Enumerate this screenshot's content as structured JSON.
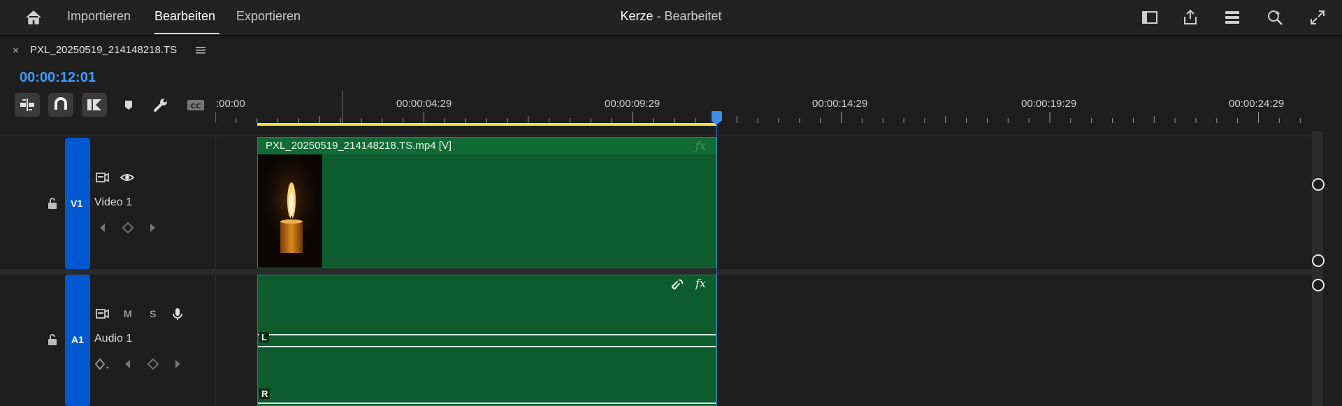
{
  "topbar": {
    "nav": [
      "Importieren",
      "Bearbeiten",
      "Exportieren"
    ],
    "active_nav": "Bearbeiten",
    "project_name": "Kerze",
    "project_status": " - Bearbeitet",
    "icons": [
      "home-icon",
      "panel-layout-icon",
      "share-icon",
      "settings-sliders-icon",
      "zoom-search-icon",
      "fullscreen-icon"
    ]
  },
  "sequence": {
    "tab_close": "×",
    "tab_label": "PXL_20250519_214148218.TS",
    "timecode": "00:00:12:01",
    "tools": [
      "insert-edit-icon",
      "snap-magnet-icon",
      "linked-selection-icon",
      "marker-icon",
      "wrench-icon",
      "captions-icon"
    ],
    "ruler_labels": [
      ":00:00",
      "00:00:04:29",
      "00:00:09:29",
      "00:00:14:29",
      "00:00:19:29",
      "00:00:24:29"
    ]
  },
  "tracks": {
    "video": {
      "id": "V1",
      "name": "Video 1"
    },
    "audio": {
      "id": "A1",
      "name": "Audio 1",
      "mute": "M",
      "solo": "S"
    }
  },
  "clips": {
    "video_label": "PXL_20250519_214148218.TS.mp4 [V]",
    "fx": "fx",
    "left_channel": "L",
    "right_channel": "R"
  },
  "colors": {
    "accent": "#3d9bff",
    "track_select": "#0058d0",
    "clip_green": "#0e5c2d",
    "inout_bar": "#f2e23a"
  }
}
